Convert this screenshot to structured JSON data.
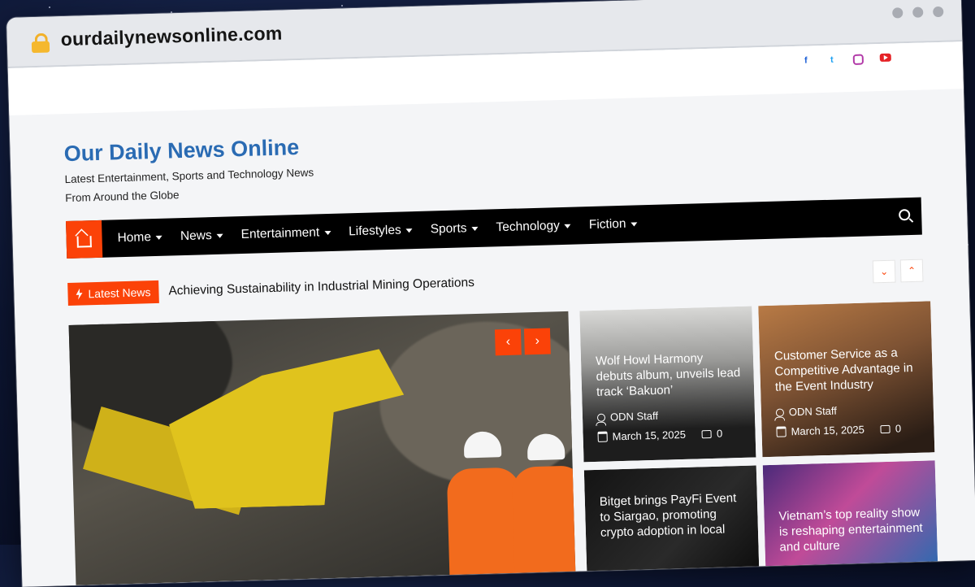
{
  "browser": {
    "url": "ourdailynewsonline.com"
  },
  "social": [
    "facebook-icon",
    "twitter-icon",
    "instagram-icon",
    "youtube-icon"
  ],
  "site": {
    "title": "Our Daily News Online",
    "tagline": "Latest Entertainment, Sports and Technology News From Around the Globe"
  },
  "nav": {
    "items": [
      "Home",
      "News",
      "Entertainment",
      "Lifestyles",
      "Sports",
      "Technology",
      "Fiction"
    ]
  },
  "ticker": {
    "badge": "Latest News",
    "headline": "Achieving Sustainability in Industrial Mining Operations"
  },
  "cards": [
    {
      "title": "Wolf Howl Harmony debuts album, unveils lead track ‘Bakuon’",
      "author": "ODN Staff",
      "date": "March 15, 2025",
      "comments": "0"
    },
    {
      "title": "Customer Service as a Competitive Advantage in the Event Industry",
      "author": "ODN Staff",
      "date": "March 15, 2025",
      "comments": "0"
    },
    {
      "title": "Bitget brings PayFi Event to Siargao, promoting crypto adoption in local",
      "author": "",
      "date": "",
      "comments": ""
    },
    {
      "title": "Vietnam’s top reality show is reshaping entertainment and culture",
      "author": "",
      "date": "",
      "comments": ""
    }
  ],
  "colors": {
    "accent": "#fb4208",
    "brand": "#2a6bb3"
  }
}
